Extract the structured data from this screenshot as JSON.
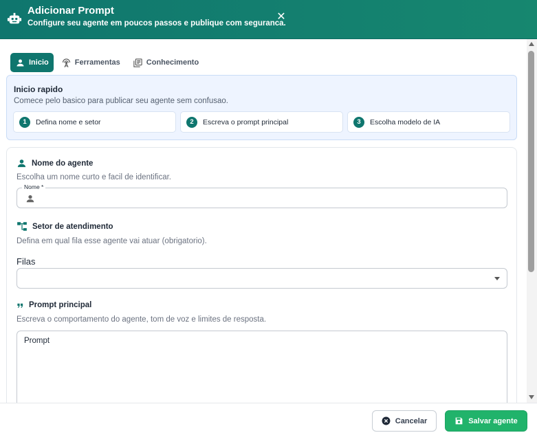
{
  "header": {
    "title": "Adicionar Prompt",
    "subtitle": "Configure seu agente em poucos passos e publique com seguranca.",
    "close_symbol": "✕",
    "icons": {
      "logo": "robot-icon",
      "close": "close-icon"
    }
  },
  "tabs": [
    {
      "label": "Inicio",
      "icon": "person-icon",
      "active": true
    },
    {
      "label": "Ferramentas",
      "icon": "antenna-icon",
      "active": false
    },
    {
      "label": "Conhecimento",
      "icon": "library-books-icon",
      "active": false
    }
  ],
  "quick_start": {
    "title": "Inicio rapido",
    "description": "Comece pelo basico para publicar seu agente sem confusao.",
    "steps": [
      {
        "number": "1",
        "label": "Defina nome e setor"
      },
      {
        "number": "2",
        "label": "Escreva o prompt principal"
      },
      {
        "number": "3",
        "label": "Escolha modelo de IA"
      }
    ]
  },
  "form": {
    "name_section": {
      "title": "Nome do agente",
      "description": "Escolha um nome curto e facil de identificar.",
      "field_label": "Nome *",
      "value": ""
    },
    "sector_section": {
      "title": "Setor de atendimento",
      "description": "Defina em qual fila esse agente vai atuar (obrigatorio).",
      "select_label": "Filas",
      "selected_value": ""
    },
    "prompt_section": {
      "title": "Prompt principal",
      "description": "Escreva o comportamento do agente, tom de voz e limites de resposta.",
      "placeholder": "Prompt"
    }
  },
  "footer": {
    "cancel_label": "Cancelar",
    "save_label": "Salvar agente"
  },
  "colors": {
    "header_bg": "#0f766e",
    "accent": "#0f766e",
    "save_button": "#21b36b",
    "quick_start_bg": "#eef4ff"
  }
}
